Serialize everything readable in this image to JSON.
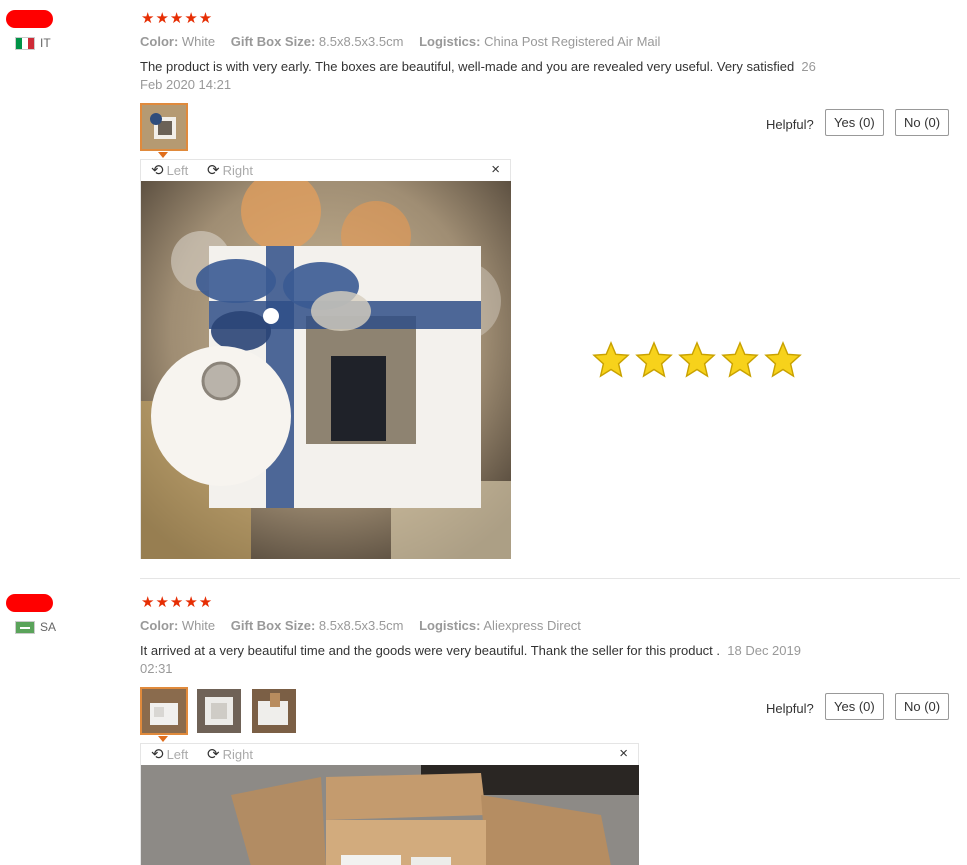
{
  "reviews": [
    {
      "country": "IT",
      "stars": "★★★★★",
      "color_label": "Color:",
      "color_value": "White",
      "size_label": "Gift Box Size:",
      "size_value": "8.5x8.5x3.5cm",
      "logistics_label": "Logistics:",
      "logistics_value": "China Post Registered Air Mail",
      "text": "The product is with very early. The boxes are beautiful, well-made and you are revealed very useful. Very satisfied",
      "date_1": "26",
      "date_2": "Feb 2020 14:21",
      "helpful": "Helpful?",
      "yes": "Yes (0)",
      "no": "No (0)",
      "viewer": {
        "left": "Left",
        "right": "Right",
        "close": "×"
      }
    },
    {
      "country": "SA",
      "stars": "★★★★★",
      "color_label": "Color:",
      "color_value": "White",
      "size_label": "Gift Box Size:",
      "size_value": "8.5x8.5x3.5cm",
      "logistics_label": "Logistics:",
      "logistics_value": "Aliexpress Direct",
      "text": "It arrived at a very beautiful time and the goods were very beautiful. Thank the seller for this product .",
      "date_1": "18 Dec 2019",
      "date_2": "02:31",
      "helpful": "Helpful?",
      "yes": "Yes (0)",
      "no": "No (0)",
      "viewer": {
        "left": "Left",
        "right": "Right",
        "close": "×"
      }
    }
  ],
  "colors": {
    "star_red": "#e62e04",
    "active_thumb": "#e08a3c",
    "gold_star": "#f7d21b"
  }
}
